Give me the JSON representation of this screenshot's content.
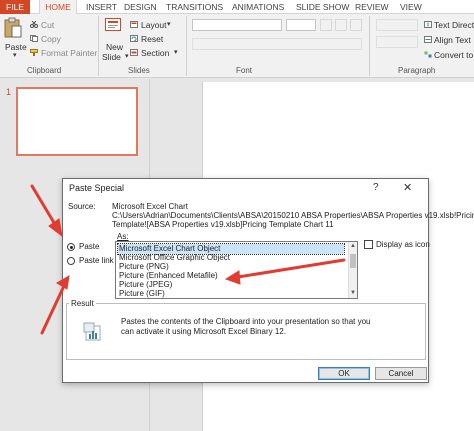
{
  "tabs": [
    "FILE",
    "HOME",
    "INSERT",
    "DESIGN",
    "TRANSITIONS",
    "ANIMATIONS",
    "SLIDE SHOW",
    "REVIEW",
    "VIEW"
  ],
  "ribbon": {
    "clipboard": {
      "paste": "Paste",
      "cut": "Cut",
      "copy": "Copy",
      "format_painter": "Format Painter",
      "label": "Clipboard"
    },
    "slides": {
      "new_slide_1": "New",
      "new_slide_2": "Slide",
      "layout": "Layout",
      "reset": "Reset",
      "section": "Section",
      "label": "Slides"
    },
    "font": {
      "label": "Font"
    },
    "paragraph": {
      "text_direction": "Text Direct",
      "align_text": "Align Text",
      "convert": "Convert to S",
      "label": "Paragraph"
    }
  },
  "thumbnails": {
    "slide_number": "1"
  },
  "dialog": {
    "title": "Paste Special",
    "help": "?",
    "close": "✕",
    "source_label": "Source:",
    "source_lines": [
      "Microsoft Excel Chart",
      "C:\\Users\\Adrian\\Documents\\Clients\\ABSA\\20150210 ABSA Properties\\ABSA Properties v19.xlsb!Pricing",
      "Template![ABSA Properties v19.xlsb]Pricing Template Chart 11"
    ],
    "as_label": "As:",
    "options": [
      "Paste",
      "Paste link"
    ],
    "list_items": [
      "Microsoft Excel Chart Object",
      "Microsoft Office Graphic Object",
      "Picture (PNG)",
      "Picture (Enhanced Metafile)",
      "Picture (JPEG)",
      "Picture (GIF)"
    ],
    "display_as_icon": "Display as icon",
    "result_label": "Result",
    "result_lines": [
      "Pastes the contents of the Clipboard into your presentation so that you",
      "can activate it using Microsoft Excel Binary 12."
    ],
    "ok": "OK",
    "cancel": "Cancel"
  },
  "colors": {
    "accent": "#d24726",
    "arrow": "#e03c31",
    "selection": "#cce4f7"
  }
}
